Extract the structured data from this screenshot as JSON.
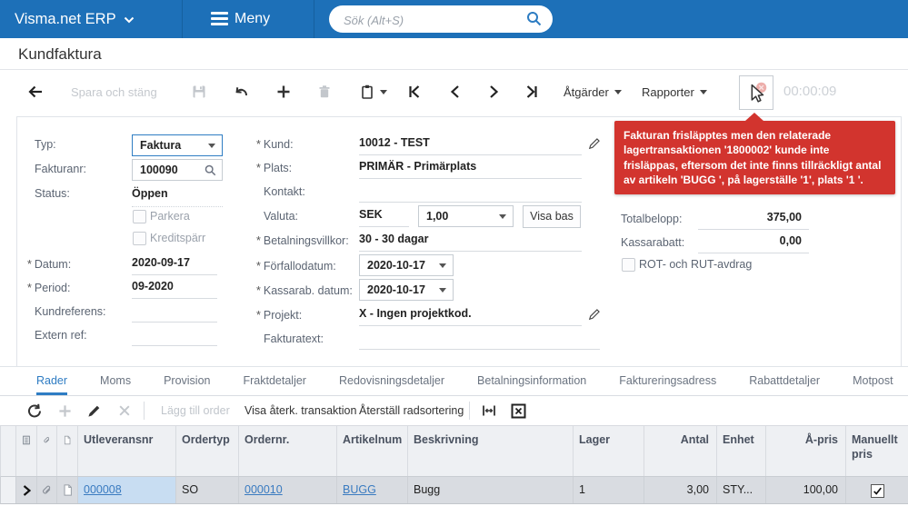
{
  "colors": {
    "topbar": "#1d70b8",
    "accent": "#2e7cc3",
    "error": "#d2342e",
    "link": "#3a7bc0"
  },
  "ui": {
    "required_mark": "*"
  },
  "icons": {
    "brand_caret": "chevron-down",
    "menu": "hamburger",
    "search": "magnifier",
    "back": "arrow-left",
    "save": "floppy-disk",
    "undo": "curved-arrow-left",
    "add": "plus",
    "delete": "trash",
    "copy": "clipboard",
    "nav": "first/prev/next/last chevrons",
    "pointer": "mouse-cursor-with-red-badge",
    "edit": "pencil",
    "refresh": "circular-arrow",
    "remove": "x-cross",
    "fit": "fit-width-arrows",
    "excel": "boxed-x",
    "notes": "lined-note",
    "attachment": "paperclip",
    "document": "file-page",
    "row_indicator": "right-chevron"
  },
  "topbar": {
    "brand": "Visma.net ERP",
    "menu_label": "Meny",
    "search_placeholder": "Sök (Alt+S)"
  },
  "page": {
    "title": "Kundfaktura",
    "timer": "00:00:09"
  },
  "toolbar": {
    "save_and_close": "Spara och stäng",
    "actions_label": "Åtgärder",
    "reports_label": "Rapporter"
  },
  "form": {
    "typ": {
      "label": "Typ:",
      "value": "Faktura"
    },
    "fakturanr": {
      "label": "Fakturanr:",
      "value": "100090"
    },
    "status": {
      "label": "Status:",
      "value": "Öppen"
    },
    "parkera": {
      "label": "Parkera",
      "checked": false
    },
    "kreditsparr": {
      "label": "Kreditspärr",
      "checked": false
    },
    "datum": {
      "label": "Datum:",
      "value": "2020-09-17"
    },
    "period": {
      "label": "Period:",
      "value": "09-2020"
    },
    "kundreferens": {
      "label": "Kundreferens:",
      "value": ""
    },
    "extern_ref": {
      "label": "Extern ref:",
      "value": ""
    },
    "kund": {
      "label": "Kund:",
      "value": "10012 - TEST"
    },
    "plats": {
      "label": "Plats:",
      "value": "PRIMÄR - Primärplats"
    },
    "kontakt": {
      "label": "Kontakt:",
      "value": ""
    },
    "valuta": {
      "label": "Valuta:",
      "currency": "SEK",
      "rate": "1,00",
      "visa_bas_label": "Visa bas"
    },
    "betalningsvillkor": {
      "label": "Betalningsvillkor:",
      "value": "30 - 30 dagar"
    },
    "forfallodatum": {
      "label": "Förfallodatum:",
      "value": "2020-10-17"
    },
    "kassarab_datum": {
      "label": "Kassarab. datum:",
      "value": "2020-10-17"
    },
    "projekt": {
      "label": "Projekt:",
      "value": "X - Ingen projektkod."
    },
    "fakturatext": {
      "label": "Fakturatext:",
      "value": ""
    }
  },
  "error_message": "Fakturan frisläpptes men den relaterade lagertransaktionen '1800002' kunde inte frisläppas, eftersom det inte finns tillräckligt antal av artikeln 'BUGG ', på lagerställe '1', plats '1 '.",
  "totals": {
    "totalbelopp": {
      "label": "Totalbelopp:",
      "value": "375,00"
    },
    "kassarabatt": {
      "label": "Kassarabatt:",
      "value": "0,00"
    },
    "rot_rut": {
      "label": "ROT- och RUT-avdrag",
      "checked": false
    }
  },
  "tabs": {
    "active": "Rader",
    "items": [
      "Rader",
      "Moms",
      "Provision",
      "Fraktdetaljer",
      "Redovisningsdetaljer",
      "Betalningsinformation",
      "Faktureringsadress",
      "Rabattdetaljer",
      "Motpost"
    ]
  },
  "gridbar": {
    "add_order": "Lägg till order",
    "show_reversing": "Visa återk. transaktion",
    "reset_sort": "Återställ radsortering"
  },
  "grid": {
    "columns": {
      "utleveransnr": "Utleveransnr",
      "ordertyp": "Ordertyp",
      "ordernr": "Ordernr.",
      "artikelnummer": "Artikelnum",
      "beskrivning": "Beskrivning",
      "lager": "Lager",
      "antal": "Antal",
      "enhet": "Enhet",
      "apris": "Å-pris",
      "manuellt_pris": "Manuellt pris"
    },
    "row": {
      "utleveransnr": "000008",
      "ordertyp": "SO",
      "ordernr": "000010",
      "artikelnummer": "BUGG",
      "beskrivning": "Bugg",
      "lager": "1",
      "antal": "3,00",
      "enhet": "STY...",
      "apris": "100,00",
      "manuellt_pris_checked": true
    }
  }
}
